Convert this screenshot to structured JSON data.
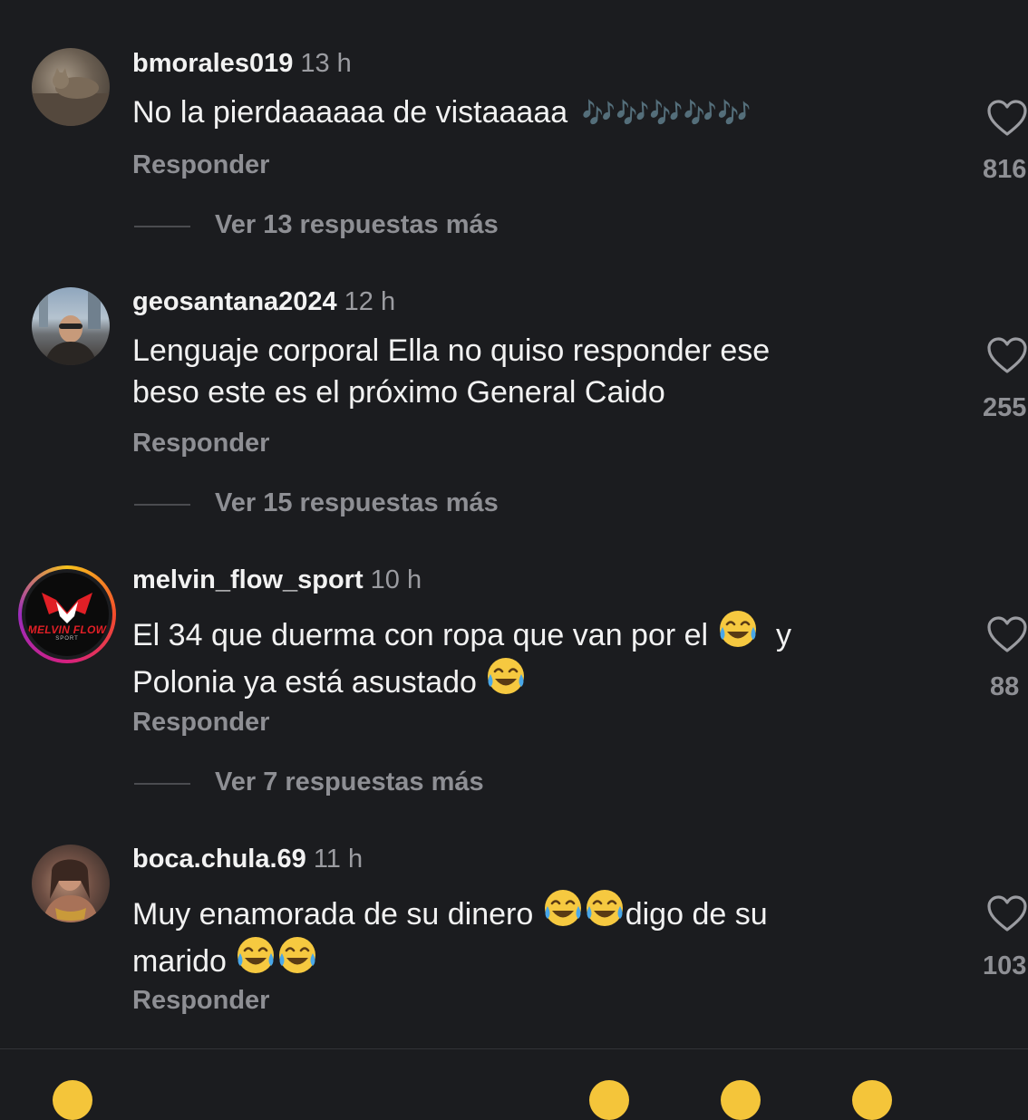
{
  "comments": [
    {
      "username": "bmorales019",
      "time": "13 h",
      "text": "No la pierdaaaaaa de vistaaaaa",
      "emoji_suffix": "🎶🎶🎶🎶🎶",
      "reply_label": "Responder",
      "more_replies": "Ver 13 respuestas más",
      "likes": "816"
    },
    {
      "username": "geosantana2024",
      "time": "12 h",
      "text_line1": "Lenguaje corporal Ella no quiso responder ese",
      "text_line2": "beso este es el próximo General Caido",
      "reply_label": "Responder",
      "more_replies": "Ver 15 respuestas más",
      "likes": "255"
    },
    {
      "username": "melvin_flow_sport",
      "time": "10 h",
      "text_part1": "El 34 que duerma con ropa que van por el",
      "text_part2": "y",
      "text_part3": "Polonia ya está asustado",
      "avatar_logo": "MELVIN FLOW",
      "avatar_logo_sub": "SPORT",
      "reply_label": "Responder",
      "more_replies": "Ver 7 respuestas más",
      "likes": "88"
    },
    {
      "username": "boca.chula.69",
      "time": "11 h",
      "text_part1": "Muy enamorada de su dinero",
      "text_part2": "digo de su",
      "text_part3": "marido",
      "reply_label": "Responder",
      "likes": "103"
    }
  ],
  "icons": {
    "like": "heart-outline-icon",
    "laugh": "face-with-tears-of-joy-emoji",
    "music": "musical-notes-emoji"
  },
  "colors": {
    "background": "#1b1c1f",
    "text": "#f2f2f2",
    "muted": "#8e8f94",
    "story_ring": "#d6207f"
  }
}
